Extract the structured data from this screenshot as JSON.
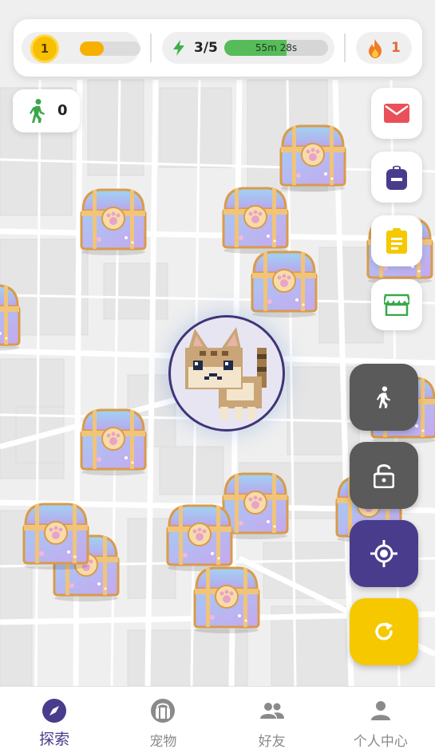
{
  "topbar": {
    "level": "1",
    "xp_progress": 0.4,
    "energy": "3/5",
    "energy_progress": 0.6,
    "timer": "55m 28s",
    "streak": "1",
    "colors": {
      "coin": "#f6c000",
      "xp": "#f6b100",
      "energy": "#57bb5a",
      "fire": "#f07b28"
    }
  },
  "steps": {
    "count": "0",
    "icon": "walking-person-icon"
  },
  "side_buttons": [
    {
      "name": "mail-button",
      "icon": "mail-icon",
      "color": "#e9505a"
    },
    {
      "name": "backpack-button",
      "icon": "backpack-icon",
      "color": "#4a3c8c"
    },
    {
      "name": "tasks-button",
      "icon": "clipboard-icon",
      "color": "#f5c800"
    },
    {
      "name": "shop-button",
      "icon": "store-icon",
      "color": "#38a84a"
    }
  ],
  "action_buttons": [
    {
      "name": "walk-mode-button",
      "icon": "walking-person-icon",
      "color": "#5a5a5a"
    },
    {
      "name": "lock-button",
      "icon": "unlock-icon",
      "color": "#5a5a5a"
    },
    {
      "name": "locate-button",
      "icon": "crosshair-icon",
      "color": "#4a3c8c"
    },
    {
      "name": "refresh-button",
      "icon": "refresh-icon",
      "color": "#f5c800"
    }
  ],
  "map": {
    "avatar": "pixel-cat-avatar",
    "chest_icon": "treasure-chest-icon"
  },
  "nav": {
    "items": [
      {
        "label": "探索",
        "icon": "compass-icon",
        "active": true
      },
      {
        "label": "宠物",
        "icon": "pet-icon",
        "active": false
      },
      {
        "label": "好友",
        "icon": "friends-icon",
        "active": false
      },
      {
        "label": "个人中心",
        "icon": "person-icon",
        "active": false
      }
    ],
    "active_color": "#4a3c8c"
  }
}
